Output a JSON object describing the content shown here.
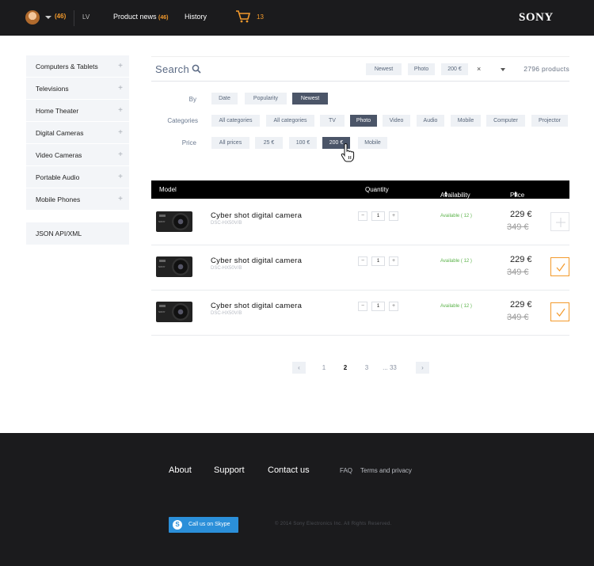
{
  "header": {
    "user_count": "(46)",
    "lang": "LV",
    "nav_news": "Product news",
    "nav_news_count": "(46)",
    "nav_history": "History",
    "cart_count": "13",
    "logo": "SONY"
  },
  "sidebar": {
    "items": [
      {
        "label": "Computers & Tablets"
      },
      {
        "label": "Televisions"
      },
      {
        "label": "Home Theater"
      },
      {
        "label": "Digital Cameras"
      },
      {
        "label": "Video Cameras"
      },
      {
        "label": "Portable Audio"
      },
      {
        "label": "Mobile Phones"
      }
    ],
    "plus": "+",
    "json_link": "JSON API/XML"
  },
  "search": {
    "label": "Search",
    "tags": [
      "Newest",
      "Photo",
      "200 €"
    ],
    "clear": "×",
    "count": "2796 products"
  },
  "filters": {
    "by_label": "By",
    "by": [
      "Date",
      "Popularity",
      "Newest"
    ],
    "categories_label": "Categories",
    "categories": [
      "All categories",
      "All categories",
      "TV",
      "Photo",
      "Video",
      "Audio",
      "Mobile",
      "Computer",
      "Projector"
    ],
    "price_label": "Price",
    "prices": [
      "All prices",
      "25 €",
      "100 €",
      "200 €",
      "Mobile"
    ]
  },
  "table": {
    "headers": {
      "model": "Model",
      "quantity": "Quantity",
      "availability": "Availability",
      "price": "Price"
    },
    "rows": [
      {
        "name": "Cyber shot digital camera",
        "code": "DSC-HX50V/B",
        "qty": "1",
        "availability": "Available ( 12 )",
        "price": "229 €",
        "old_price": "349 €",
        "selected": false
      },
      {
        "name": "Cyber shot digital camera",
        "code": "DSC-HX50V/B",
        "qty": "1",
        "availability": "Available ( 12 )",
        "price": "229 €",
        "old_price": "349 €",
        "selected": true
      },
      {
        "name": "Cyber shot digital camera",
        "code": "DSC-HX50V/B",
        "qty": "1",
        "availability": "Available ( 12 )",
        "price": "229 €",
        "old_price": "349 €",
        "selected": true
      }
    ],
    "qty_minus": "−",
    "qty_plus": "+"
  },
  "pagination": {
    "prev": "‹",
    "pages": [
      "1",
      "2",
      "3",
      "... 33"
    ],
    "current": "2",
    "next": "›"
  },
  "footer": {
    "about": "About",
    "support": "Support",
    "contact": "Contact us",
    "faq": "FAQ",
    "terms": "Terms and privacy",
    "skype": "Call us on Skype",
    "copyright": "© 2014 Sony Electronics Inc. All Rights Reserved."
  },
  "colors": {
    "accent": "#f39a2c",
    "dark": "#1b1b1d",
    "chip": "#eef1f5",
    "chip_active": "#4b5568",
    "available": "#5bb34a",
    "skype": "#2b8fd9"
  }
}
